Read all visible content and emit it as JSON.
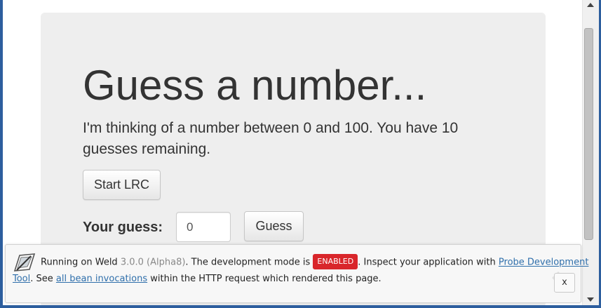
{
  "page": {
    "title": "Guess a number...",
    "description": "I'm thinking of a number between 0 and 100. You have 10 guesses remaining.",
    "start_button": "Start LRC",
    "guess_label": "Your guess:",
    "guess_value": "0",
    "guess_button": "Guess"
  },
  "dev_bar": {
    "running_on": "Running on Weld",
    "version": "3.0.0 (Alpha8)",
    "dev_mode_text": ". The development mode is",
    "badge": "ENABLED",
    "inspect_text": ". Inspect your application with",
    "probe_link_part1": "Probe Development",
    "probe_link_part2": "Tool",
    "see_text": ". See",
    "invocations_link": "all bean invocations",
    "request_text": "within the HTTP request which rendered this page.",
    "close_label": "x"
  },
  "colors": {
    "jumbotron_bg": "#eeeeee",
    "badge_bg": "#d9262b",
    "link": "#2f6fab",
    "window_frame": "#2d5e9e"
  },
  "icons": {
    "logo": "weld-logo-icon",
    "close": "close-icon"
  }
}
